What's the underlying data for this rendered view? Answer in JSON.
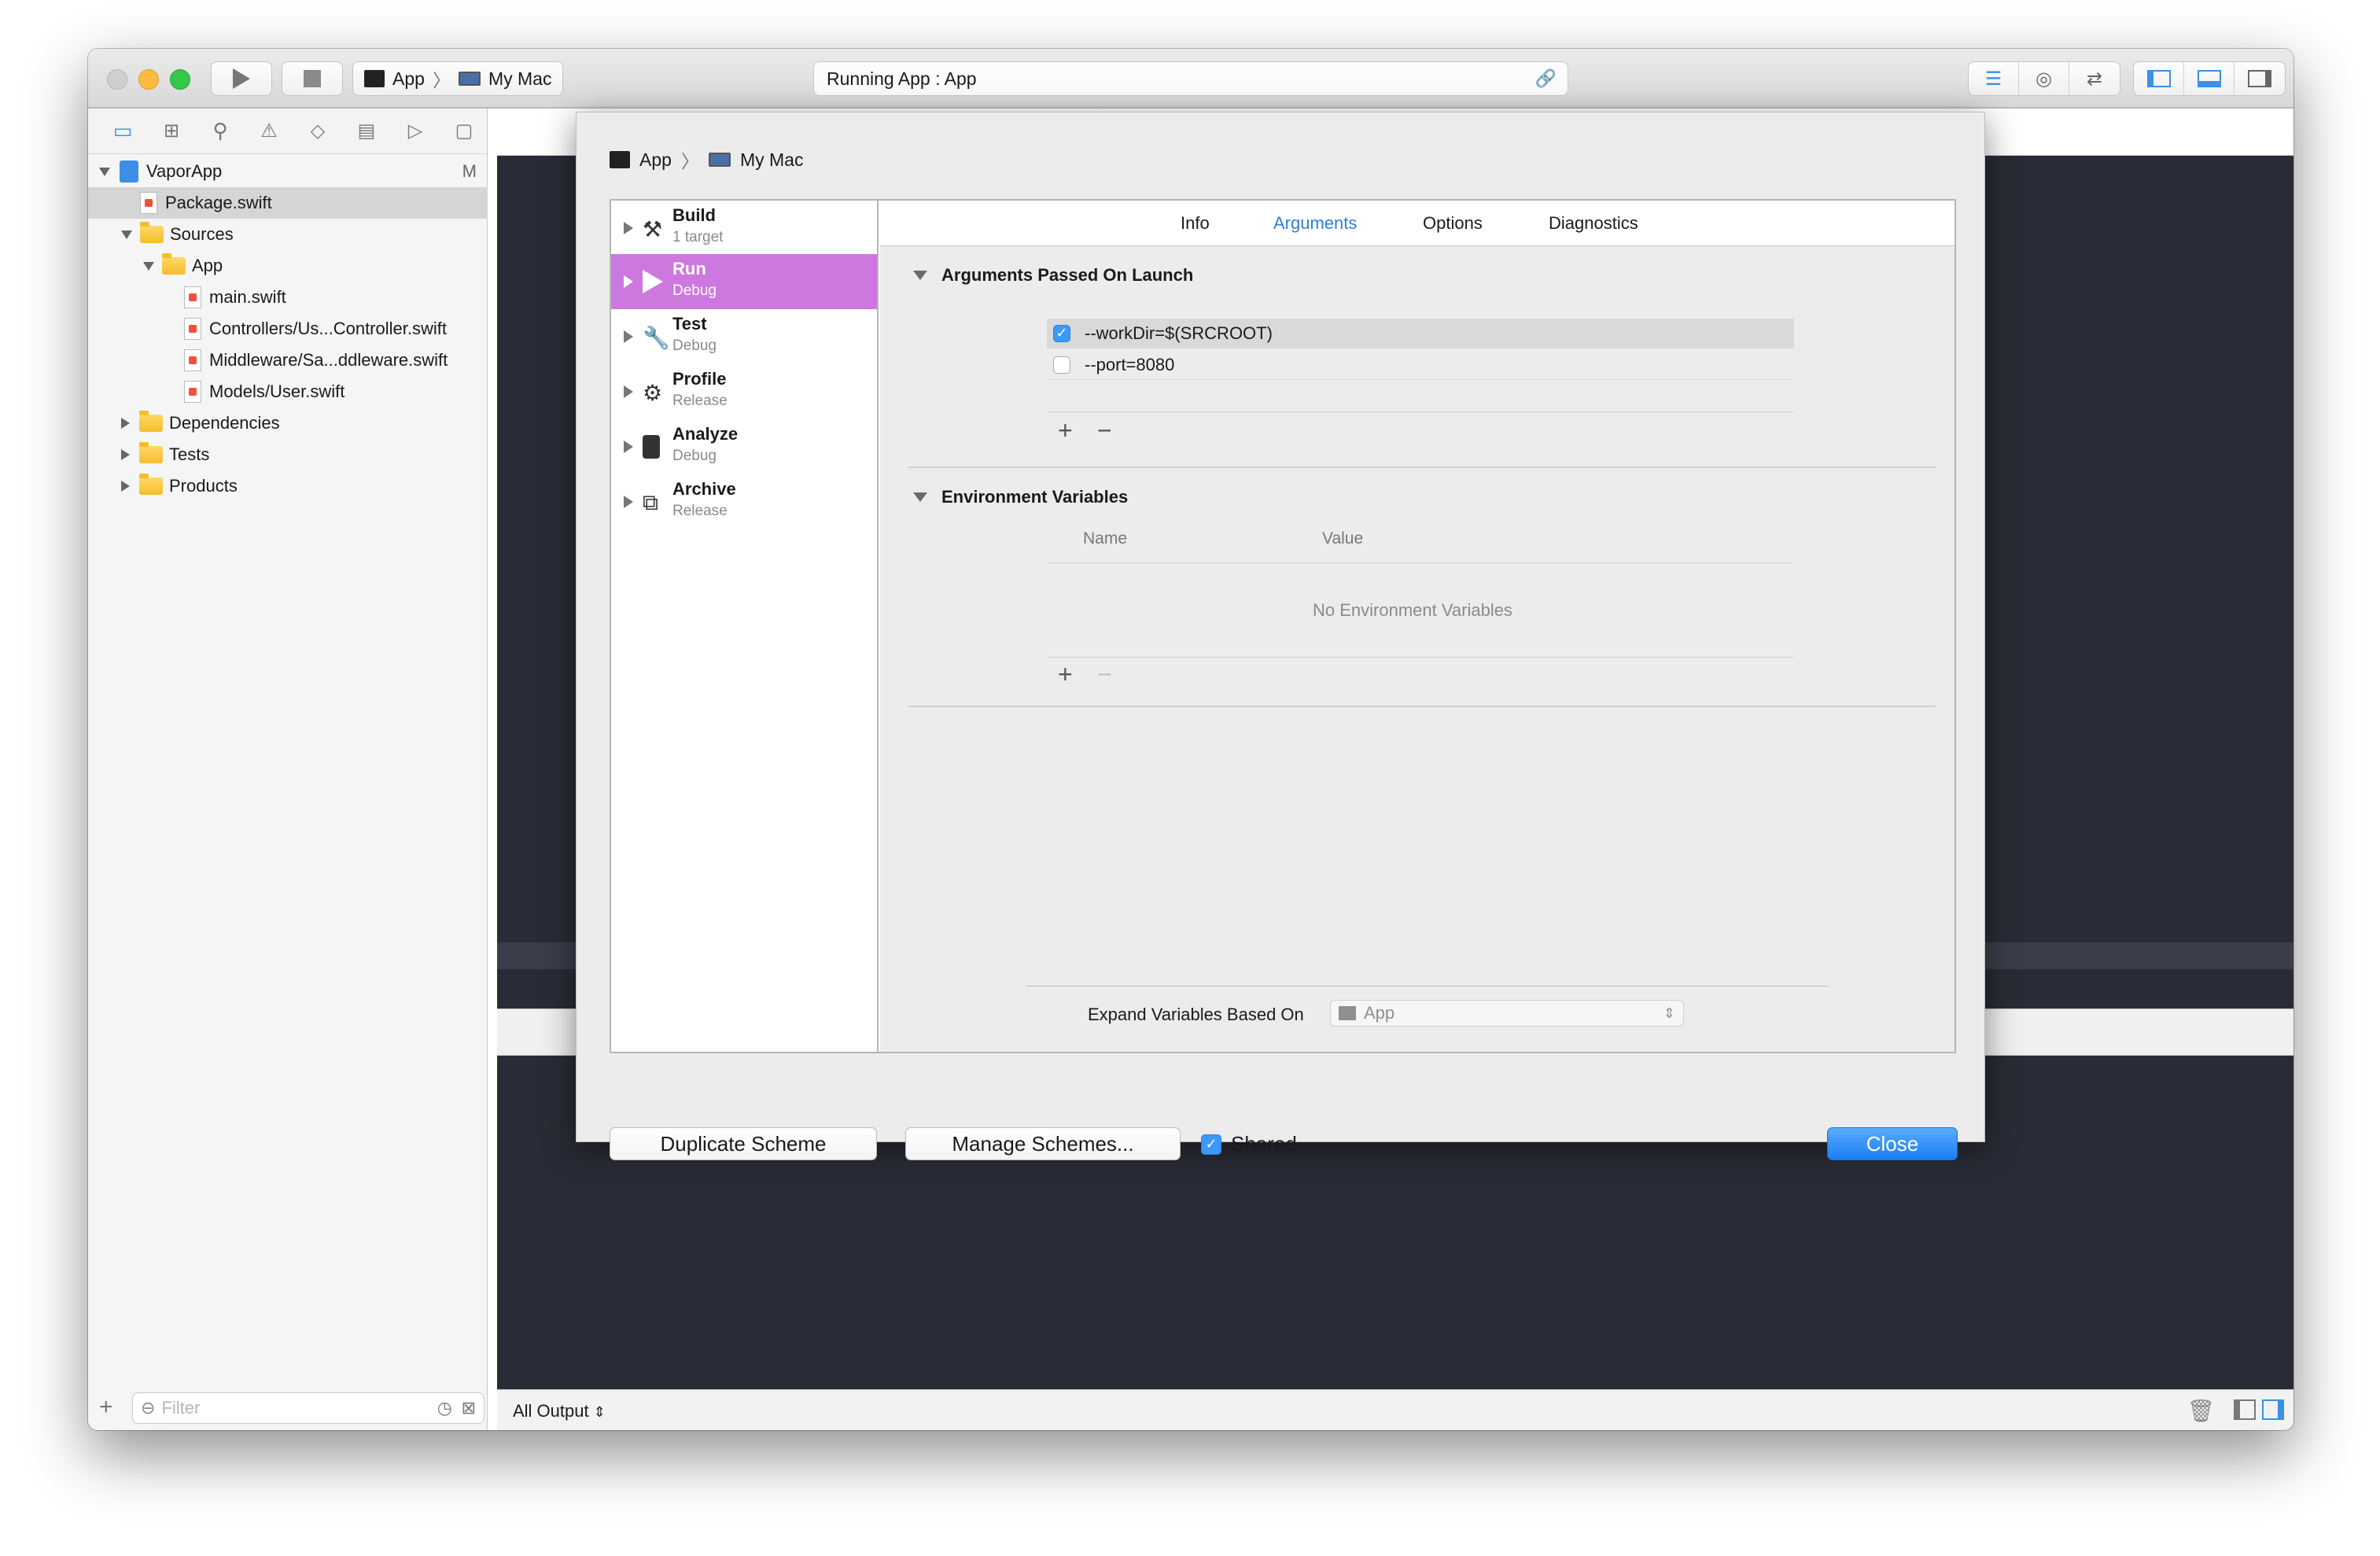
{
  "toolbar": {
    "scheme": "App",
    "destination": "My Mac",
    "activity": "Running App : App"
  },
  "navigator": {
    "project": "VaporApp",
    "project_badge": "M",
    "items": [
      {
        "label": "Package.swift"
      },
      {
        "label": "Sources"
      },
      {
        "label": "App"
      },
      {
        "label": "main.swift"
      },
      {
        "label": "Controllers/Us...Controller.swift"
      },
      {
        "label": "Middleware/Sa...ddleware.swift"
      },
      {
        "label": "Models/User.swift"
      },
      {
        "label": "Dependencies"
      },
      {
        "label": "Tests"
      },
      {
        "label": "Products"
      }
    ],
    "filter_placeholder": "Filter"
  },
  "sheet": {
    "scheme": "App",
    "destination": "My Mac",
    "actions": [
      {
        "name": "Build",
        "sub": "1 target"
      },
      {
        "name": "Run",
        "sub": "Debug"
      },
      {
        "name": "Test",
        "sub": "Debug"
      },
      {
        "name": "Profile",
        "sub": "Release"
      },
      {
        "name": "Analyze",
        "sub": "Debug"
      },
      {
        "name": "Archive",
        "sub": "Release"
      }
    ],
    "tabs": [
      "Info",
      "Arguments",
      "Options",
      "Diagnostics"
    ],
    "active_tab": "Arguments",
    "args_title": "Arguments Passed On Launch",
    "arguments": [
      {
        "value": "--workDir=$(SRCROOT)",
        "checked": true
      },
      {
        "value": "--port=8080",
        "checked": false
      }
    ],
    "env_title": "Environment Variables",
    "env_col_name": "Name",
    "env_col_value": "Value",
    "env_empty": "No Environment Variables",
    "expand_label": "Expand Variables Based On",
    "expand_value": "App",
    "duplicate": "Duplicate Scheme",
    "manage": "Manage Schemes...",
    "shared": "Shared",
    "close": "Close"
  },
  "console": {
    "output": "All Output"
  },
  "colors": {
    "accent": "#1a7df5",
    "run_selected": "#cd78df",
    "editor_bg": "#292b36",
    "tab_active": "#2f7fd6"
  }
}
